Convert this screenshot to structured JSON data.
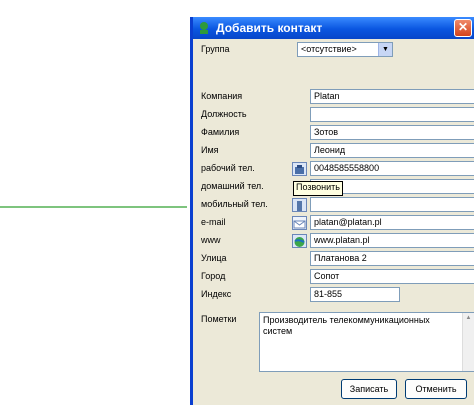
{
  "window": {
    "title": "Добавить контакт",
    "close_glyph": "✕"
  },
  "group": {
    "label": "Группа",
    "value": "<отсутствие>"
  },
  "fields": [
    {
      "label": "Компания",
      "value": "Platan"
    },
    {
      "label": "Должность",
      "value": ""
    },
    {
      "label": "Фамилия",
      "value": "Зотов"
    },
    {
      "label": "Имя",
      "value": "Леонид"
    },
    {
      "label": "рабочий тел.",
      "value": "0048585558800"
    },
    {
      "label": "домашний тел.",
      "value": ""
    },
    {
      "label": "мобильный тел.",
      "value": ""
    },
    {
      "label": "e-mail",
      "value": "platan@platan.pl"
    },
    {
      "label": "www",
      "value": "www.platan.pl"
    },
    {
      "label": "Улица",
      "value": "Платанова 2"
    },
    {
      "label": "Город",
      "value": "Сопот"
    },
    {
      "label": "Индекс",
      "value": "81-855"
    }
  ],
  "notes": {
    "label": "Пометки",
    "value": "Производитель телекоммуникационных систем"
  },
  "tooltip": "Позвонить",
  "buttons": {
    "save": "Записать",
    "cancel": "Отменить"
  },
  "icons": {
    "phone": "phone-icon",
    "mobile": "mobile-icon",
    "email": "email-icon",
    "web": "globe-icon"
  }
}
